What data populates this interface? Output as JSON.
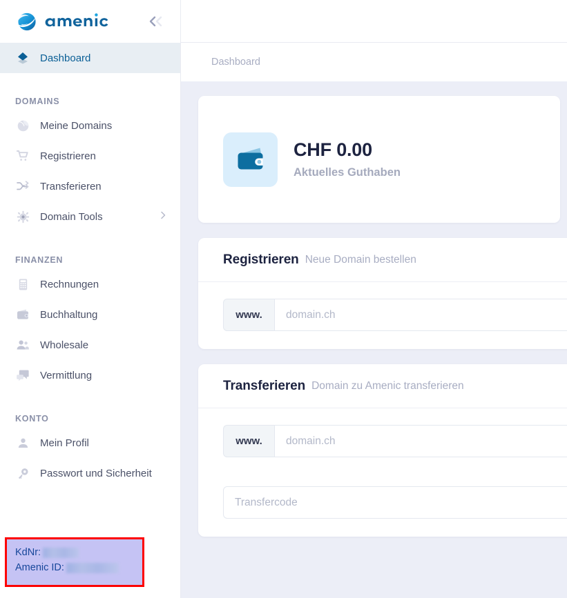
{
  "brand": {
    "name": "amenic",
    "logo_icon": "amenic-swoosh-logo",
    "collapse_icon": "chevron-double-left-icon",
    "colors": {
      "logo_blue": "#0e7cc4",
      "logo_dark": "#10639c",
      "accent": "#0a5f96",
      "page_bg": "#eceef7",
      "card_bg": "#ffffff",
      "sidebar_bg": "#ffffff",
      "active_item_bg": "#e8eef3",
      "muted_text": "#a8adc2",
      "highlight_border": "#fd0000",
      "highlight_bg": "#c5c3f4",
      "highlight_text": "#16469a",
      "wallet_badge_bg": "#daeefc",
      "wallet_body": "#0d6ea0"
    }
  },
  "sidebar": {
    "primary": [
      {
        "label": "Dashboard",
        "icon": "layers-diamond-icon",
        "active": true,
        "has_submenu": false
      }
    ],
    "sections": [
      {
        "title": "DOMAINS",
        "items": [
          {
            "label": "Meine Domains",
            "icon": "globe-icon",
            "has_submenu": false
          },
          {
            "label": "Registrieren",
            "icon": "shopping-cart-icon",
            "has_submenu": false
          },
          {
            "label": "Transferieren",
            "icon": "shuffle-arrows-icon",
            "has_submenu": false
          },
          {
            "label": "Domain Tools",
            "icon": "gear-icon",
            "has_submenu": true
          }
        ]
      },
      {
        "title": "FINANZEN",
        "items": [
          {
            "label": "Rechnungen",
            "icon": "calculator-icon",
            "has_submenu": false
          },
          {
            "label": "Buchhaltung",
            "icon": "wallet-icon",
            "has_submenu": false
          },
          {
            "label": "Wholesale",
            "icon": "users-icon",
            "has_submenu": false
          },
          {
            "label": "Vermittlung",
            "icon": "chat-bubbles-icon",
            "has_submenu": false
          }
        ]
      },
      {
        "title": "KONTO",
        "items": [
          {
            "label": "Mein Profil",
            "icon": "user-icon",
            "has_submenu": false
          },
          {
            "label": "Passwort und Sicherheit",
            "icon": "key-icon",
            "has_submenu": false
          }
        ]
      }
    ],
    "account_box": {
      "kdnr_label": "KdNr:",
      "kdnr_value": "",
      "amenic_id_label": "Amenic ID:",
      "amenic_id_value": "",
      "redacted": true
    }
  },
  "breadcrumb": {
    "current": "Dashboard"
  },
  "main": {
    "balance_card": {
      "icon": "wallet-icon",
      "amount": "CHF 0.00",
      "label": "Aktuelles Guthaben"
    },
    "register_card": {
      "title": "Registrieren",
      "subtitle": "Neue Domain bestellen",
      "prefix": "www.",
      "domain_placeholder": "domain.ch",
      "domain_value": ""
    },
    "transfer_card": {
      "title": "Transferieren",
      "subtitle": "Domain zu Amenic transferieren",
      "prefix": "www.",
      "domain_placeholder": "domain.ch",
      "domain_value": "",
      "code_placeholder": "Transfercode",
      "code_value": ""
    }
  }
}
